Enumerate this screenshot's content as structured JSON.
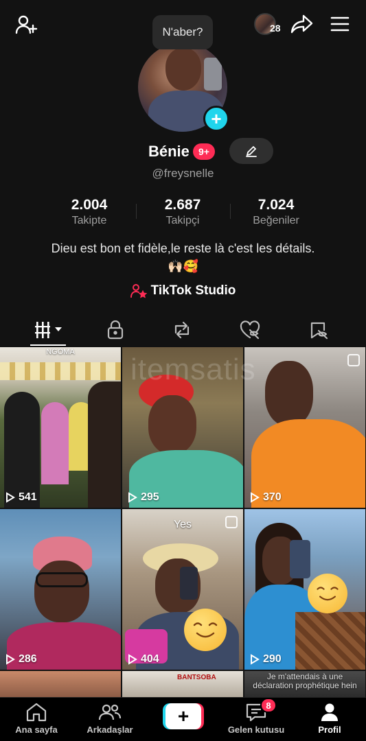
{
  "header": {
    "status_bubble": "N'aber?",
    "story_count": "28"
  },
  "profile": {
    "name": "Bénie",
    "notif_badge": "9+",
    "handle": "@freysnelle",
    "bio_line1": "Dieu est bon et fidèle,le reste là c'est les détails.",
    "bio_emoji": "🙌🏻🥰",
    "studio_label": "TikTok Studio"
  },
  "stats": [
    {
      "value": "2.004",
      "label": "Takipte"
    },
    {
      "value": "2.687",
      "label": "Takipçi"
    },
    {
      "value": "7.024",
      "label": "Beğeniler"
    }
  ],
  "tabs": [
    "videos-tab",
    "private-tab",
    "reposts-tab",
    "liked-tab",
    "favorites-tab"
  ],
  "videos": [
    {
      "views": "541",
      "caption": "NGOMA"
    },
    {
      "views": "295",
      "caption": ""
    },
    {
      "views": "370",
      "caption": ""
    },
    {
      "views": "286",
      "caption": ""
    },
    {
      "views": "404",
      "caption": "Yes"
    },
    {
      "views": "290",
      "caption": ""
    }
  ],
  "partial_row": {
    "caption_line1": "Je m'attendais à une",
    "caption_line2": "déclaration prophétique hein",
    "banner_text": "BANTSOBA"
  },
  "watermark": "itemsatis",
  "nav": {
    "home": "Ana sayfa",
    "friends": "Arkadaşlar",
    "inbox": "Gelen kutusu",
    "inbox_badge": "8",
    "profile": "Profil"
  },
  "colors": {
    "background": "#121212",
    "accent_pink": "#fe2c55",
    "accent_cyan": "#20d5ec"
  }
}
